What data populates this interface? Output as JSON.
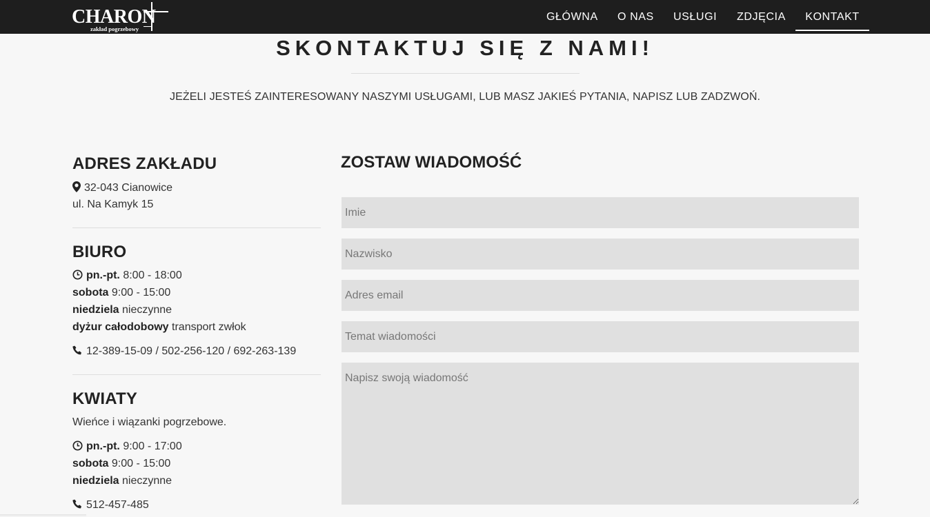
{
  "logo": {
    "word": "CHARON",
    "subtitle": "zakład pogrzebowy"
  },
  "nav": {
    "items": [
      {
        "label": "GŁÓWNA"
      },
      {
        "label": "O NAS"
      },
      {
        "label": "USŁUGI"
      },
      {
        "label": "ZDJĘCIA"
      },
      {
        "label": "KONTAKT",
        "active": true
      }
    ]
  },
  "hero": {
    "title": "SKONTAKTUJ SIĘ Z NAMI!",
    "subtitle": "JEŻELI JESTEŚ ZAINTERESOWANY NASZYMI USŁUGAMI, LUB MASZ JAKIEŚ PYTANIA, NAPISZ LUB ZADZWOŃ."
  },
  "address": {
    "title": "ADRES ZAKŁADU",
    "line1": "32-043 Cianowice",
    "line2": "ul. Na Kamyk 15"
  },
  "office": {
    "title": "BIURO",
    "hours": [
      {
        "day": "pn.-pt.",
        "time": "8:00 - 18:00"
      },
      {
        "day": "sobota",
        "time": "9:00 - 15:00"
      },
      {
        "day": "niedziela",
        "time": "nieczynne"
      },
      {
        "day": "dyżur całodobowy",
        "time": "transport zwłok"
      }
    ],
    "phone": "12-389-15-09 / 502-256-120 / 692-263-139"
  },
  "flowers": {
    "title": "KWIATY",
    "description": "Wieńce i wiązanki pogrzebowe.",
    "hours": [
      {
        "day": "pn.-pt.",
        "time": "9:00 - 17:00"
      },
      {
        "day": "sobota",
        "time": "9:00 - 15:00"
      },
      {
        "day": "niedziela",
        "time": "nieczynne"
      }
    ],
    "phone": "512-457-485"
  },
  "form": {
    "title": "ZOSTAW WIADOMOŚĆ",
    "first_name_placeholder": "Imie",
    "last_name_placeholder": "Nazwisko",
    "email_placeholder": "Adres email",
    "subject_placeholder": "Temat wiadomości",
    "message_placeholder": "Napisz swoją wiadomość"
  },
  "icons": {
    "address": "map-marker-icon",
    "hours": "clock-icon",
    "phone": "phone-icon"
  }
}
